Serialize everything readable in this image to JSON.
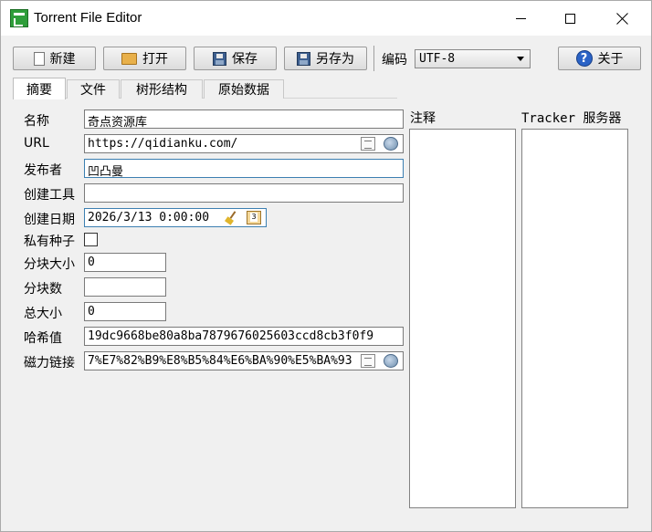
{
  "window": {
    "title": "Torrent File Editor",
    "accent": "#2e9e3a"
  },
  "toolbar": {
    "new_label": "新建",
    "open_label": "打开",
    "save_label": "保存",
    "save_as_label": "另存为",
    "encoding_label": "编码",
    "encoding_value": "UTF-8",
    "about_label": "关于"
  },
  "tabs": [
    {
      "label": "摘要",
      "active": true
    },
    {
      "label": "文件",
      "active": false
    },
    {
      "label": "树形结构",
      "active": false
    },
    {
      "label": "原始数据",
      "active": false
    }
  ],
  "form": {
    "name": {
      "label": "名称",
      "value": "奇点资源库"
    },
    "url": {
      "label": "URL",
      "value": "https://qidianku.com/"
    },
    "publisher": {
      "label": "发布者",
      "value": "凹凸曼"
    },
    "created_by": {
      "label": "创建工具",
      "value": ""
    },
    "creation_date": {
      "label": "创建日期",
      "value": "2026/3/13 0:00:00"
    },
    "private": {
      "label": "私有种子",
      "checked": false
    },
    "piece_size": {
      "label": "分块大小",
      "value": "0"
    },
    "piece_count": {
      "label": "分块数",
      "value": ""
    },
    "total_size": {
      "label": "总大小",
      "value": "0"
    },
    "hash": {
      "label": "哈希值",
      "value": "19dc9668be80a8ba7879676025603ccd8cb3f0f9"
    },
    "magnet": {
      "label": "磁力链接",
      "value": "7%E7%82%B9%E8%B5%84%E6%BA%90%E5%BA%93"
    }
  },
  "panels": {
    "comment_title": "注释",
    "trackers_title": "Tracker 服务器"
  },
  "icons": [
    "app-icon",
    "doc-icon",
    "folder-icon",
    "save-icon",
    "help-icon",
    "copy-icon",
    "globe-icon",
    "broom-icon",
    "calendar-icon"
  ]
}
